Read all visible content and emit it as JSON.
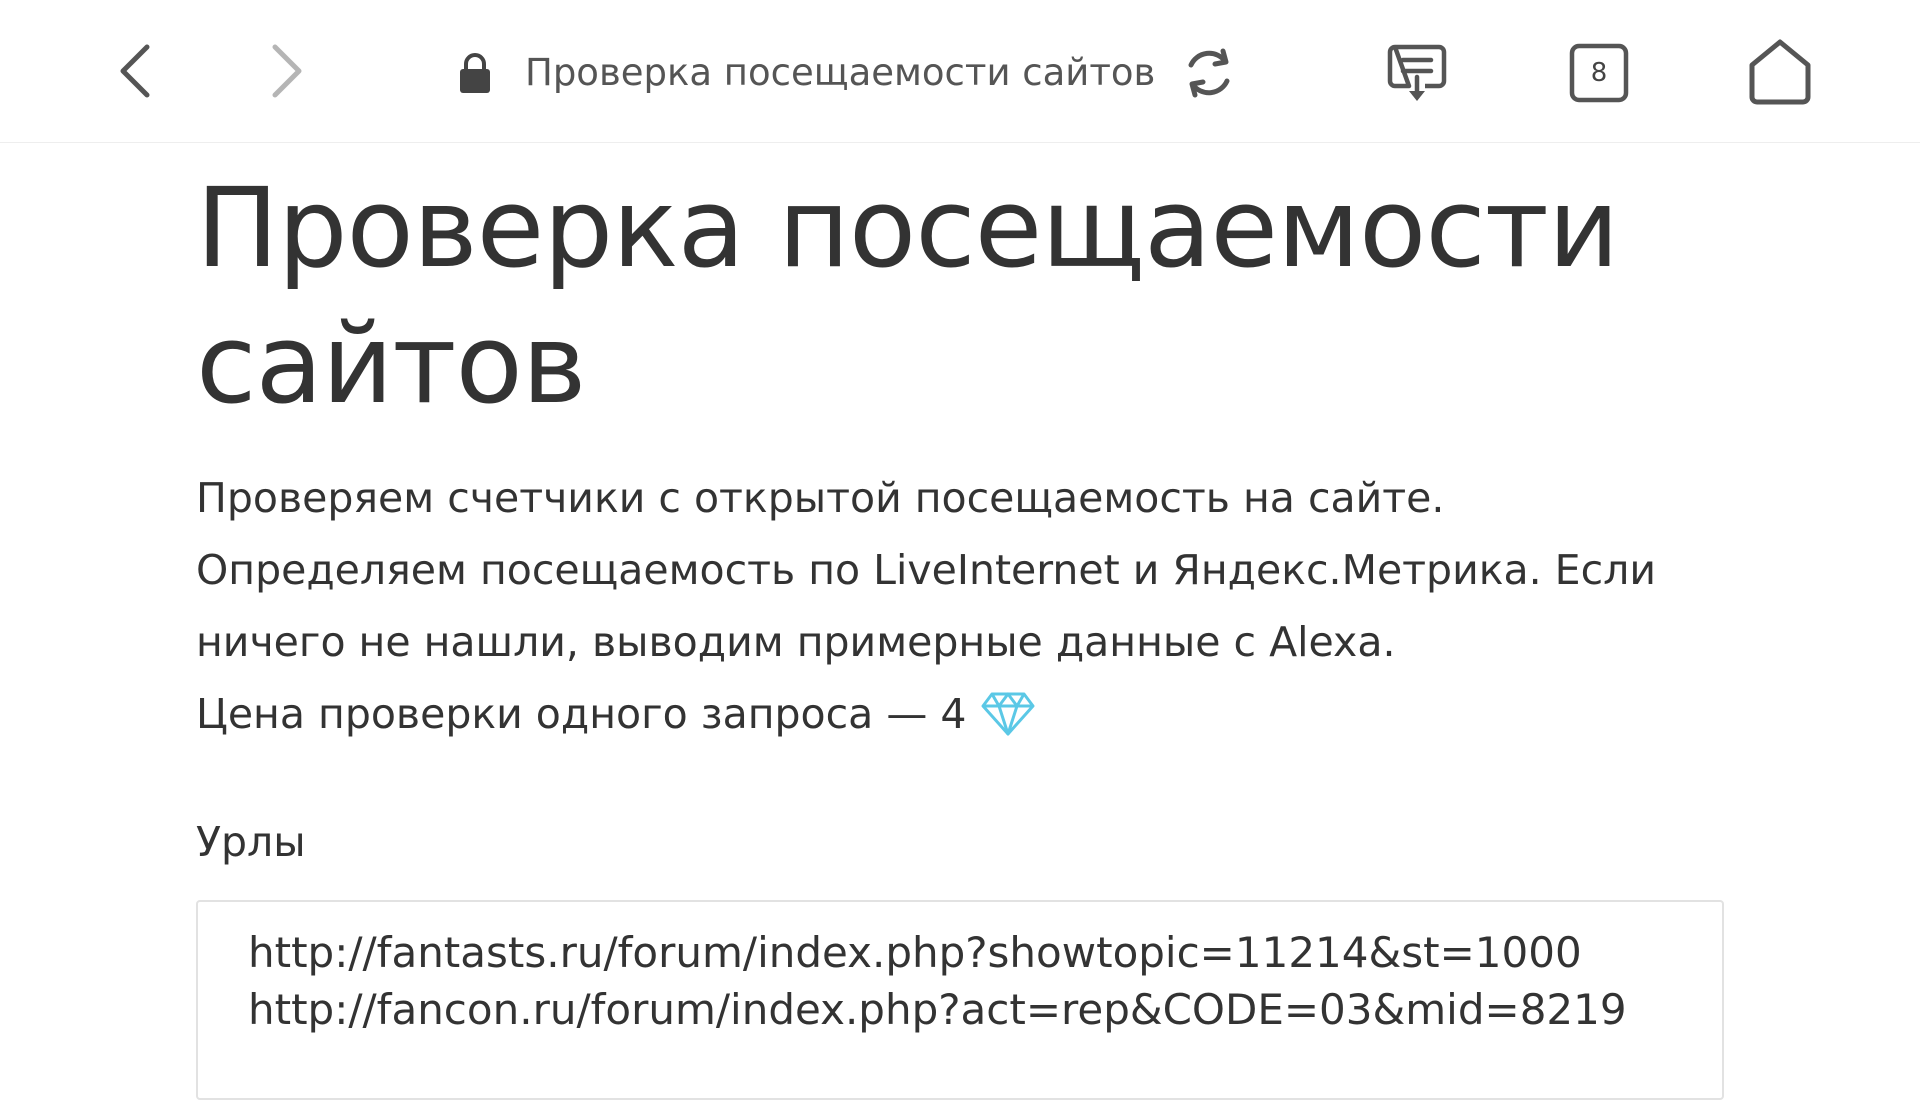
{
  "toolbar": {
    "title": "Проверка посещаемости сайтов",
    "tabs_count": "8",
    "icons": {
      "back": "back-arrow-icon",
      "forward": "forward-arrow-icon",
      "lock": "lock-icon",
      "reload": "reload-icon",
      "reader": "reader-download-icon",
      "tabs": "tabs-icon",
      "home": "home-icon"
    }
  },
  "page": {
    "title_line1": "Проверка посещаемости",
    "title_line2": "сайтов",
    "desc_line1": "Проверяем счетчики с открытой посещаемость на сайте.",
    "desc_line2": "Определяем посещаемость по LiveInternet и Яндекс.Метрика. Если",
    "desc_line3": "ничего не нашли, выводим примерные данные с Alexa.",
    "price_text": "Цена проверки одного запроса — 4",
    "price_icon": "diamond-icon",
    "field_label": "Урлы",
    "urls_value": "http://fantasts.ru/forum/index.php?showtopic=11214&st=1000\nhttp://fancon.ru/forum/index.php?act=rep&CODE=03&mid=8219"
  },
  "colors": {
    "text": "#333333",
    "diamond": "#5bc8e6",
    "icon": "#555555"
  }
}
